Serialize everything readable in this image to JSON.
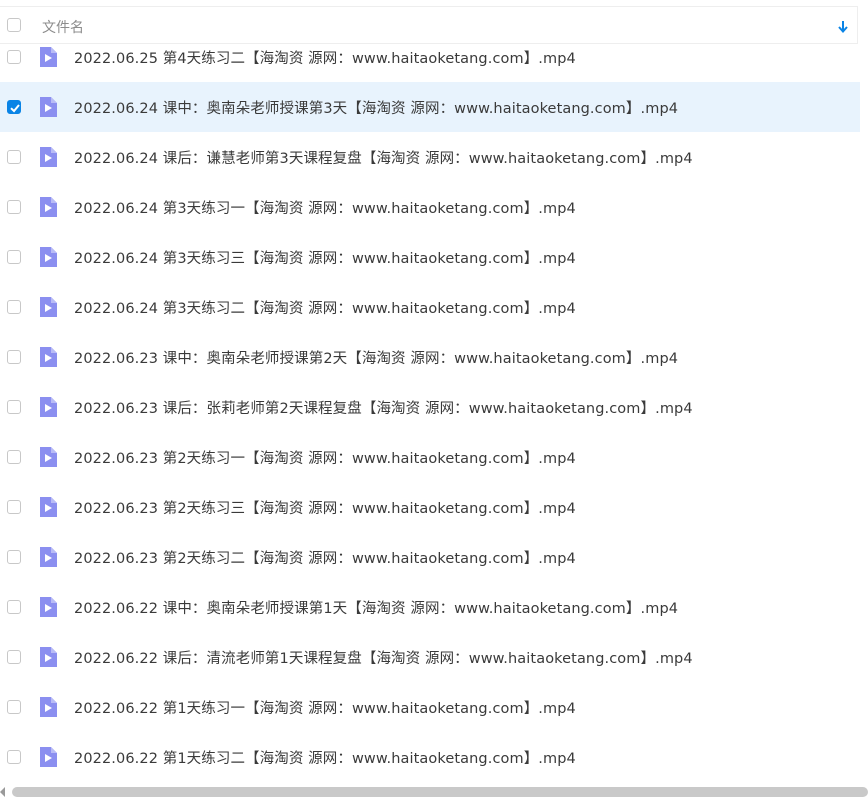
{
  "header": {
    "column_label": "文件名",
    "sort_icon": "arrow-down-icon"
  },
  "colors": {
    "accent": "#0a84e6",
    "file_icon": "#8b8ff0",
    "selected_row": "#e8f3fd"
  },
  "files": [
    {
      "name": "2022.06.25 第4天练习二【海淘资 源网：www.haitaoketang.com】.mp4",
      "checked": false
    },
    {
      "name": "2022.06.24 课中：奥南朵老师授课第3天【海淘资 源网：www.haitaoketang.com】.mp4",
      "checked": true
    },
    {
      "name": "2022.06.24 课后：谦慧老师第3天课程复盘【海淘资 源网：www.haitaoketang.com】.mp4",
      "checked": false
    },
    {
      "name": "2022.06.24 第3天练习一【海淘资 源网：www.haitaoketang.com】.mp4",
      "checked": false
    },
    {
      "name": "2022.06.24 第3天练习三【海淘资 源网：www.haitaoketang.com】.mp4",
      "checked": false
    },
    {
      "name": "2022.06.24 第3天练习二【海淘资 源网：www.haitaoketang.com】.mp4",
      "checked": false
    },
    {
      "name": "2022.06.23 课中：奥南朵老师授课第2天【海淘资 源网：www.haitaoketang.com】.mp4",
      "checked": false
    },
    {
      "name": "2022.06.23 课后：张莉老师第2天课程复盘【海淘资 源网：www.haitaoketang.com】.mp4",
      "checked": false
    },
    {
      "name": "2022.06.23 第2天练习一【海淘资 源网：www.haitaoketang.com】.mp4",
      "checked": false
    },
    {
      "name": "2022.06.23 第2天练习三【海淘资 源网：www.haitaoketang.com】.mp4",
      "checked": false
    },
    {
      "name": "2022.06.23 第2天练习二【海淘资 源网：www.haitaoketang.com】.mp4",
      "checked": false
    },
    {
      "name": "2022.06.22 课中：奥南朵老师授课第1天【海淘资 源网：www.haitaoketang.com】.mp4",
      "checked": false
    },
    {
      "name": "2022.06.22 课后：清流老师第1天课程复盘【海淘资 源网：www.haitaoketang.com】.mp4",
      "checked": false
    },
    {
      "name": "2022.06.22 第1天练习一【海淘资 源网：www.haitaoketang.com】.mp4",
      "checked": false
    },
    {
      "name": "2022.06.22 第1天练习二【海淘资 源网：www.haitaoketang.com】.mp4",
      "checked": false
    }
  ]
}
